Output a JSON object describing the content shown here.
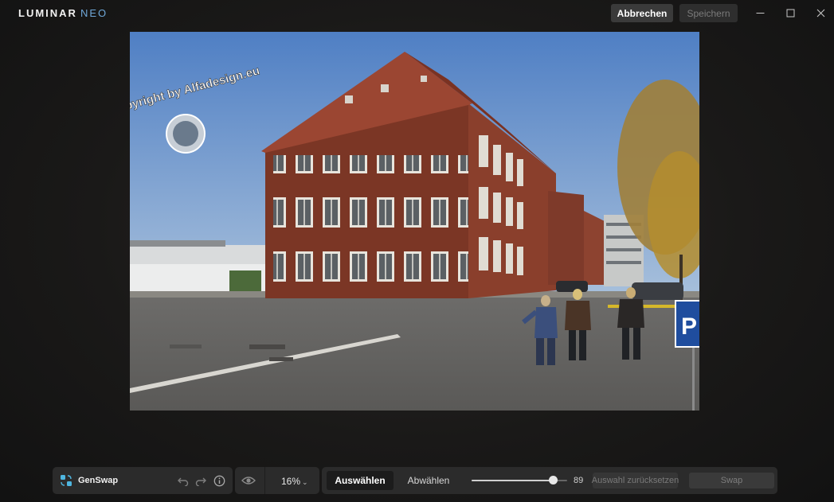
{
  "app": {
    "logo_main": "LUMINAR",
    "logo_sub": "NEO"
  },
  "titlebar": {
    "cancel_label": "Abbrechen",
    "save_label": "Speichern",
    "minimize_icon": "minimize-icon",
    "maximize_icon": "maximize-icon",
    "close_icon": "close-icon"
  },
  "photo": {
    "watermark_text": "Copyright by Alfadesign.eu",
    "sign_letter": "P"
  },
  "toolbar": {
    "tool_name": "GenSwap",
    "zoom_value": "16%",
    "select_label": "Auswählen",
    "deselect_label": "Abwählen",
    "brush_size": "89",
    "brush_fraction": 0.85,
    "reset_label": "Auswahl zurücksetzen",
    "swap_label": "Swap"
  },
  "colors": {
    "accent": "#6fa8d8",
    "panel_bg": "#2b2b2b",
    "gen_icon": "#4fb6e0"
  }
}
